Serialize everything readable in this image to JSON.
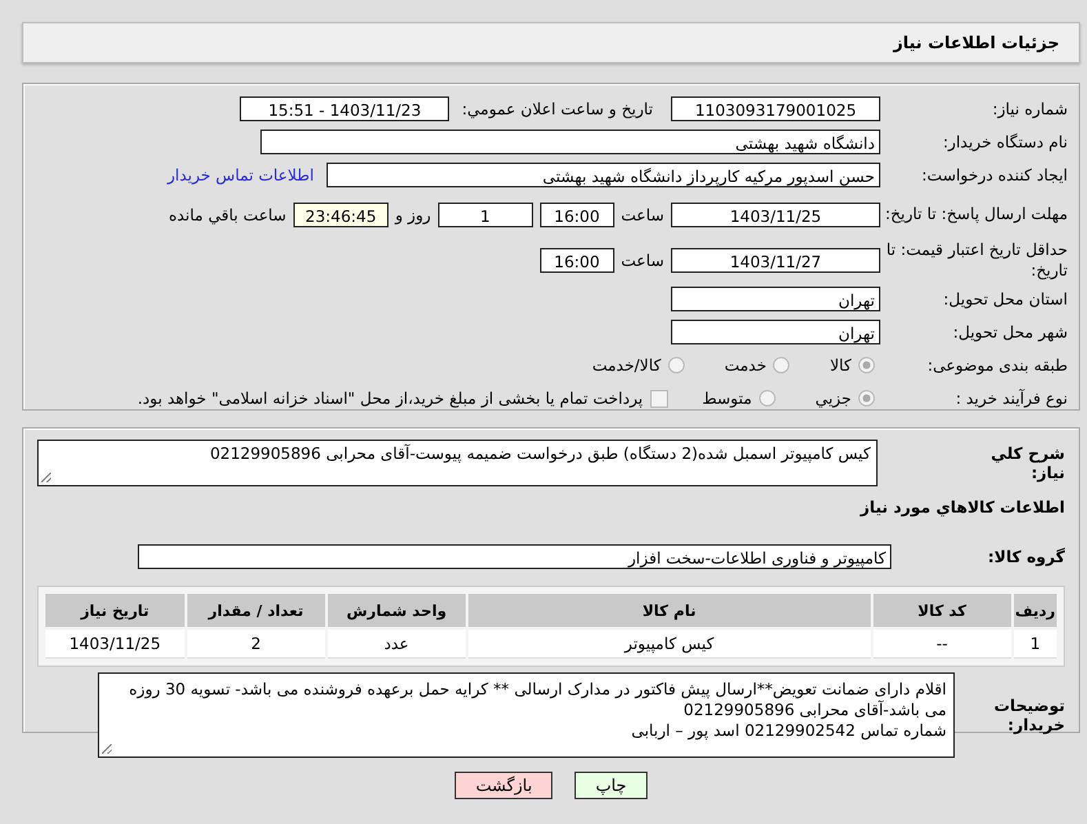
{
  "page_title": "جزئیات اطلاعات نیاز",
  "need_number": {
    "label": "شماره نیاز:",
    "value": "1103093179001025"
  },
  "announce": {
    "label": "تاریخ و ساعت اعلان عمومي:",
    "value": "1403/11/23 - 15:51"
  },
  "buyer_org": {
    "label": "نام دستگاه خریدار:",
    "value": "دانشگاه شهید بهشتی"
  },
  "requester": {
    "label": "ایجاد کننده درخواست:",
    "value": "حسن اسدپور مرکیه کارپرداز دانشگاه شهید بهشتی",
    "link": "اطلاعات تماس خریدار"
  },
  "deadline": {
    "label": "مهلت ارسال پاسخ: تا تاریخ:",
    "date": "1403/11/25",
    "time_label": "ساعت",
    "time": "16:00",
    "days": "1",
    "days_label": "روز و",
    "remaining": "23:46:45",
    "remaining_label": "ساعت باقي مانده"
  },
  "validity": {
    "label": "حداقل تاریخ اعتبار قیمت: تا تاریخ:",
    "date": "1403/11/27",
    "time_label": "ساعت",
    "time": "16:00"
  },
  "province": {
    "label": "استان محل تحویل:",
    "value": "تهران"
  },
  "city": {
    "label": "شهر محل تحویل:",
    "value": "تهران"
  },
  "category": {
    "label": "طبقه بندی موضوعی:",
    "options": [
      {
        "label": "کالا",
        "selected": true
      },
      {
        "label": "خدمت",
        "selected": false
      },
      {
        "label": "کالا/خدمت",
        "selected": false
      }
    ]
  },
  "purchase_type": {
    "label": "نوع فرآیند خرید :",
    "options": [
      {
        "label": "جزیي",
        "selected": true
      },
      {
        "label": "متوسط",
        "selected": false
      }
    ],
    "payment": {
      "checked": false,
      "text": "پرداخت تمام یا بخشی از مبلغ خرید،از محل \"اسناد خزانه اسلامی\" خواهد بود."
    }
  },
  "general_desc": {
    "label": "شرح کلي نیاز:",
    "value": "کیس کامپیوتر اسمبل شده(2 دستگاه) طبق درخواست ضمیمه پیوست-آقای محرابی 02129905896"
  },
  "goods_heading": "اطلاعات کالاهاي مورد نیاز",
  "goods_group": {
    "label": "گروه کالا:",
    "value": "کامپیوتر و فناوری اطلاعات-سخت افزار"
  },
  "table": {
    "columns": [
      "ردیف",
      "کد کالا",
      "نام کالا",
      "واحد شمارش",
      "تعداد / مقدار",
      "تاریخ نیاز"
    ],
    "rows": [
      [
        "1",
        "--",
        "کیس کامپیوتر",
        "عدد",
        "2",
        "1403/11/25"
      ]
    ]
  },
  "buyer_notes": {
    "label": "توضیحات خریدار:",
    "lines": [
      "اقلام دارای ضمانت تعویض**ارسال پیش فاکتور در مدارک ارسالی **  کرایه حمل برعهده فروشنده می باشد- تسویه 30 روزه می باشد-آقای محرابی 02129905896",
      "شماره تماس 02129902542 اسد پور – اربابی"
    ]
  },
  "buttons": [
    {
      "label": "چاپ",
      "kind": "print"
    },
    {
      "label": "بازگشت",
      "kind": "back"
    }
  ]
}
